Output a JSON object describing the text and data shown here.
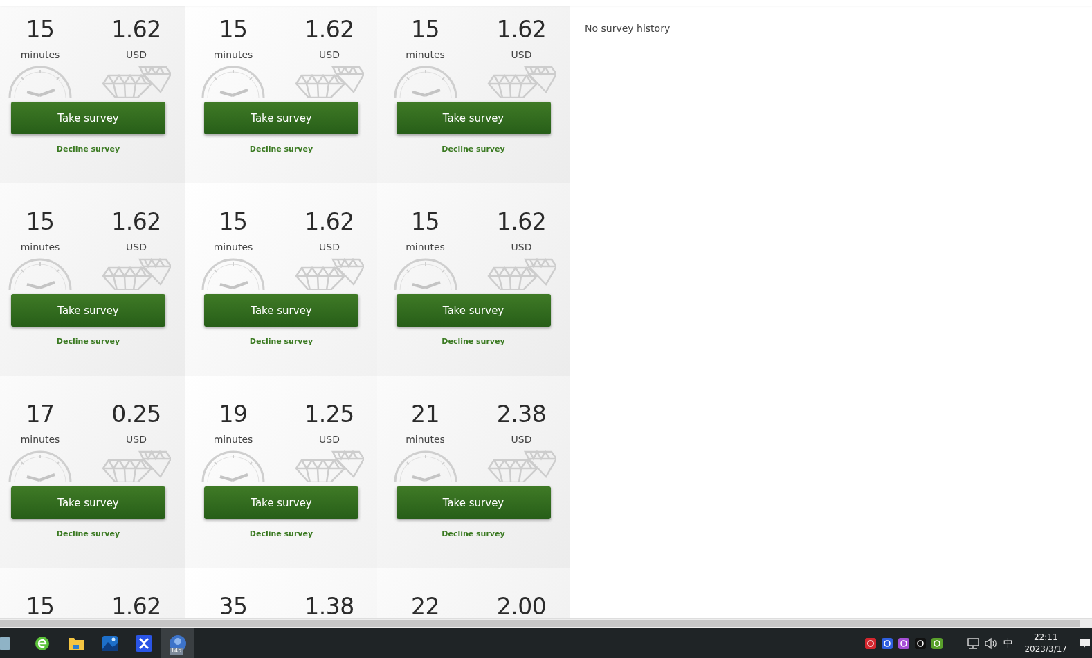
{
  "surveys": [
    {
      "minutes": "15",
      "minutes_label": "minutes",
      "amount": "1.62",
      "currency": "USD",
      "button": "Take survey",
      "decline": "Decline survey"
    },
    {
      "minutes": "15",
      "minutes_label": "minutes",
      "amount": "1.62",
      "currency": "USD",
      "button": "Take survey",
      "decline": "Decline survey"
    },
    {
      "minutes": "15",
      "minutes_label": "minutes",
      "amount": "1.62",
      "currency": "USD",
      "button": "Take survey",
      "decline": "Decline survey"
    },
    {
      "minutes": "15",
      "minutes_label": "minutes",
      "amount": "1.62",
      "currency": "USD",
      "button": "Take survey",
      "decline": "Decline survey"
    },
    {
      "minutes": "15",
      "minutes_label": "minutes",
      "amount": "1.62",
      "currency": "USD",
      "button": "Take survey",
      "decline": "Decline survey"
    },
    {
      "minutes": "15",
      "minutes_label": "minutes",
      "amount": "1.62",
      "currency": "USD",
      "button": "Take survey",
      "decline": "Decline survey"
    },
    {
      "minutes": "17",
      "minutes_label": "minutes",
      "amount": "0.25",
      "currency": "USD",
      "button": "Take survey",
      "decline": "Decline survey"
    },
    {
      "minutes": "19",
      "minutes_label": "minutes",
      "amount": "1.25",
      "currency": "USD",
      "button": "Take survey",
      "decline": "Decline survey"
    },
    {
      "minutes": "21",
      "minutes_label": "minutes",
      "amount": "2.38",
      "currency": "USD",
      "button": "Take survey",
      "decline": "Decline survey"
    },
    {
      "minutes": "15",
      "amount": "1.62"
    },
    {
      "minutes": "35",
      "amount": "1.38"
    },
    {
      "minutes": "22",
      "amount": "2.00"
    }
  ],
  "survey_history": {
    "empty_text": "No survey history"
  },
  "taskbar": {
    "apps": [
      {
        "kind": "notes",
        "selected": false
      },
      {
        "kind": "browser",
        "selected": false
      },
      {
        "kind": "folder",
        "selected": false
      },
      {
        "kind": "photos",
        "selected": false
      },
      {
        "kind": "cross",
        "selected": false
      },
      {
        "kind": "badge",
        "selected": true,
        "badge": "145"
      }
    ],
    "tray": [
      {
        "kind": "red"
      },
      {
        "kind": "blue"
      },
      {
        "kind": "purple"
      },
      {
        "kind": "note"
      },
      {
        "kind": "green"
      }
    ],
    "input_method": "中",
    "time": "22:11",
    "date": "2023/3/17"
  }
}
